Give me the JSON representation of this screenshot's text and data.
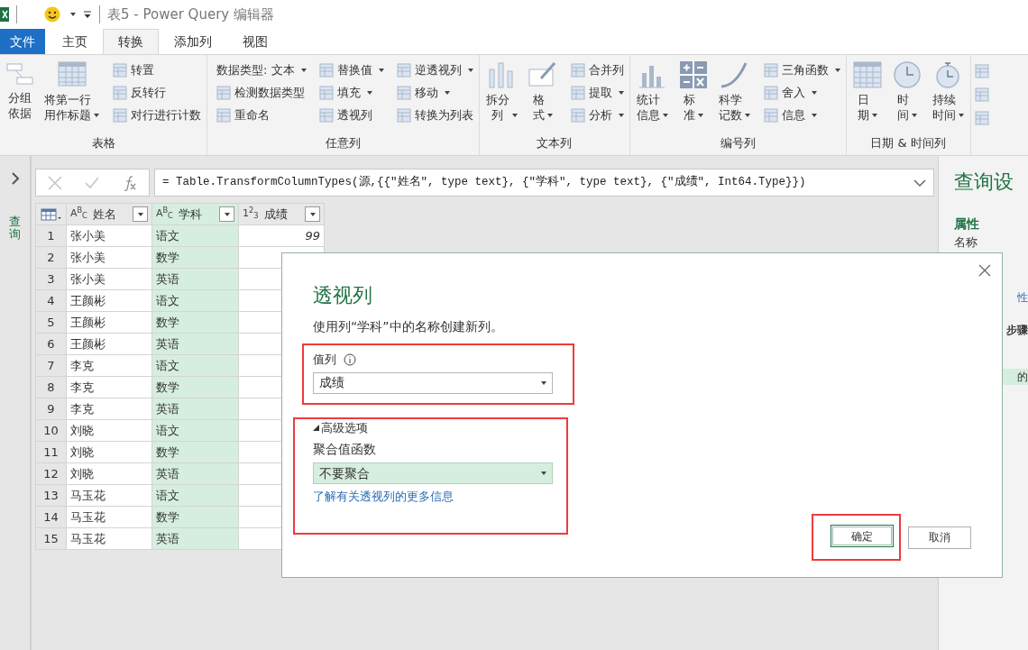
{
  "title_bar": {
    "title": "表5 - Power Query 编辑器"
  },
  "ribbon_tabs": [
    {
      "label": "文件",
      "kind": "file",
      "selected": false
    },
    {
      "label": "主页",
      "kind": "tab",
      "selected": false
    },
    {
      "label": "转换",
      "kind": "tab",
      "selected": true
    },
    {
      "label": "添加列",
      "kind": "tab",
      "selected": false
    },
    {
      "label": "视图",
      "kind": "tab",
      "selected": false
    }
  ],
  "ribbon_groups": [
    {
      "label": "表格",
      "items": [
        {
          "kind": "large",
          "label": "分组依据",
          "menu": false
        },
        {
          "kind": "large",
          "label": "将第一行用作标题",
          "menu": true
        },
        {
          "kind": "stack",
          "items": [
            {
              "label": "转置",
              "menu": false
            },
            {
              "label": "反转行",
              "menu": false
            },
            {
              "label": "对行进行计数",
              "menu": false
            }
          ]
        }
      ]
    },
    {
      "label": "任意列",
      "items": [
        {
          "kind": "stack",
          "items": [
            {
              "label": "数据类型: 文本",
              "menu": true
            },
            {
              "label": "检测数据类型",
              "menu": false
            },
            {
              "label": "重命名",
              "menu": false
            }
          ]
        },
        {
          "kind": "stack",
          "items": [
            {
              "label": "替换值",
              "menu": true
            },
            {
              "label": "填充",
              "menu": true
            },
            {
              "label": "透视列",
              "menu": false
            }
          ]
        },
        {
          "kind": "stack",
          "items": [
            {
              "label": "逆透视列",
              "menu": true
            },
            {
              "label": "移动",
              "menu": true
            },
            {
              "label": "转换为列表",
              "menu": false
            }
          ]
        }
      ]
    },
    {
      "label": "文本列",
      "items": [
        {
          "kind": "large",
          "label": "拆分列",
          "menu": true
        },
        {
          "kind": "large",
          "label": "格式",
          "menu": true
        },
        {
          "kind": "stack",
          "items": [
            {
              "label": "合并列",
              "menu": false
            },
            {
              "label": "提取",
              "menu": true
            },
            {
              "label": "分析",
              "menu": true
            }
          ]
        }
      ]
    },
    {
      "label": "编号列",
      "items": [
        {
          "kind": "large",
          "label": "统计信息",
          "menu": true
        },
        {
          "kind": "large",
          "label": "标准",
          "menu": true
        },
        {
          "kind": "large",
          "label": "科学记数",
          "menu": true
        },
        {
          "kind": "stack",
          "items": [
            {
              "label": "三角函数",
              "menu": true
            },
            {
              "label": "舍入",
              "menu": true
            },
            {
              "label": "信息",
              "menu": true
            }
          ]
        }
      ]
    },
    {
      "label": "日期 & 时间列",
      "items": [
        {
          "kind": "large",
          "label": "日期",
          "menu": true
        },
        {
          "kind": "large",
          "label": "时间",
          "menu": true
        },
        {
          "kind": "large",
          "label": "持续时间",
          "menu": true
        }
      ]
    }
  ],
  "sidebar": {
    "label": "查询"
  },
  "formula_bar": {
    "formula": "= Table.TransformColumnTypes(源,{{\"姓名\", type text}, {\"学科\", type text}, {\"成绩\", Int64.Type}})"
  },
  "table": {
    "columns": [
      {
        "type_label": "A$^{B}$$_{C}$",
        "label": "姓名",
        "selected": false
      },
      {
        "type_label": "A$^{B}$$_{C}$",
        "label": "学科",
        "selected": true
      },
      {
        "type_label": "1$^{2}$$_{3}$",
        "label": "成绩",
        "selected": false
      }
    ],
    "rows": [
      {
        "index": "1",
        "cells": [
          "张小美",
          "语文",
          "99"
        ]
      },
      {
        "index": "2",
        "cells": [
          "张小美",
          "数学"
        ]
      },
      {
        "index": "3",
        "cells": [
          "张小美",
          "英语"
        ]
      },
      {
        "index": "4",
        "cells": [
          "王颜彬",
          "语文"
        ]
      },
      {
        "index": "5",
        "cells": [
          "王颜彬",
          "数学"
        ]
      },
      {
        "index": "6",
        "cells": [
          "王颜彬",
          "英语"
        ]
      },
      {
        "index": "7",
        "cells": [
          "李克",
          "语文"
        ]
      },
      {
        "index": "8",
        "cells": [
          "李克",
          "数学"
        ]
      },
      {
        "index": "9",
        "cells": [
          "李克",
          "英语"
        ]
      },
      {
        "index": "10",
        "cells": [
          "刘晓",
          "语文"
        ]
      },
      {
        "index": "11",
        "cells": [
          "刘晓",
          "数学"
        ]
      },
      {
        "index": "12",
        "cells": [
          "刘晓",
          "英语"
        ]
      },
      {
        "index": "13",
        "cells": [
          "马玉花",
          "语文"
        ]
      },
      {
        "index": "14",
        "cells": [
          "马玉花",
          "数学"
        ]
      },
      {
        "index": "15",
        "cells": [
          "马玉花",
          "英语"
        ]
      }
    ]
  },
  "settings_panel": {
    "title": "查询设",
    "section": "属性",
    "name_label": "名称",
    "fragments": [
      {
        "kind": "link",
        "text": "性"
      },
      {
        "kind": "heading",
        "text": "步骤"
      },
      {
        "kind": "step",
        "text": "的"
      }
    ]
  },
  "dialog": {
    "title": "透视列",
    "description": "使用列“学科”中的名称创建新列。",
    "value_section": {
      "highlighted": true,
      "label": "值列",
      "value": "成绩"
    },
    "advanced_section": {
      "highlighted": true,
      "expanded": true,
      "toggle_label": "高级选项",
      "label": "聚合值函数",
      "value": "不要聚合",
      "link": "了解有关透视列的更多信息"
    },
    "buttons": [
      {
        "label": "确定",
        "kind": "primary",
        "highlighted": true
      },
      {
        "label": "取消",
        "kind": "secondary",
        "highlighted": false
      }
    ]
  }
}
